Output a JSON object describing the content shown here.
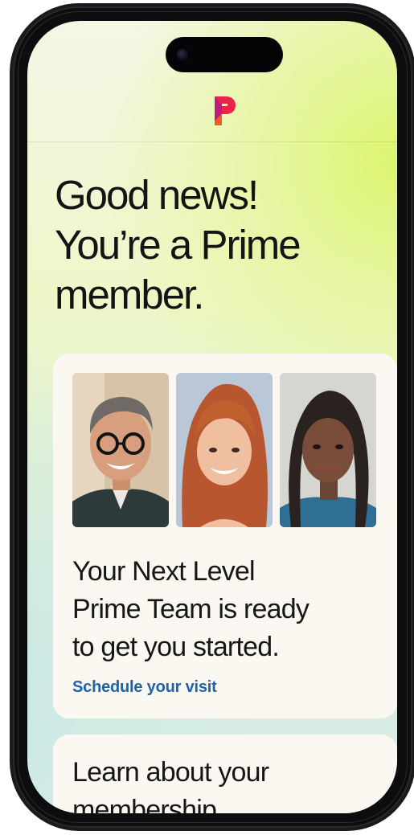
{
  "brand": {
    "logo_icon": "prime-p-logo-icon",
    "logo_colors": [
      "#e8244a",
      "#c01a7a",
      "#f05a28"
    ]
  },
  "hero": {
    "line1": "Good news!",
    "line2": "You’re a Prime",
    "line3": "member."
  },
  "team_card": {
    "photos": [
      {
        "icon": "man-portrait-photo"
      },
      {
        "icon": "woman-redhead-portrait-photo"
      },
      {
        "icon": "woman-braids-portrait-photo"
      }
    ],
    "line1": "Your Next Level",
    "line2": "Prime Team is ready",
    "line3": "to get you started.",
    "link_label": "Schedule your visit",
    "link_color": "#1e63a8"
  },
  "learn_card": {
    "line1": "Learn about your",
    "line2": "membership"
  }
}
